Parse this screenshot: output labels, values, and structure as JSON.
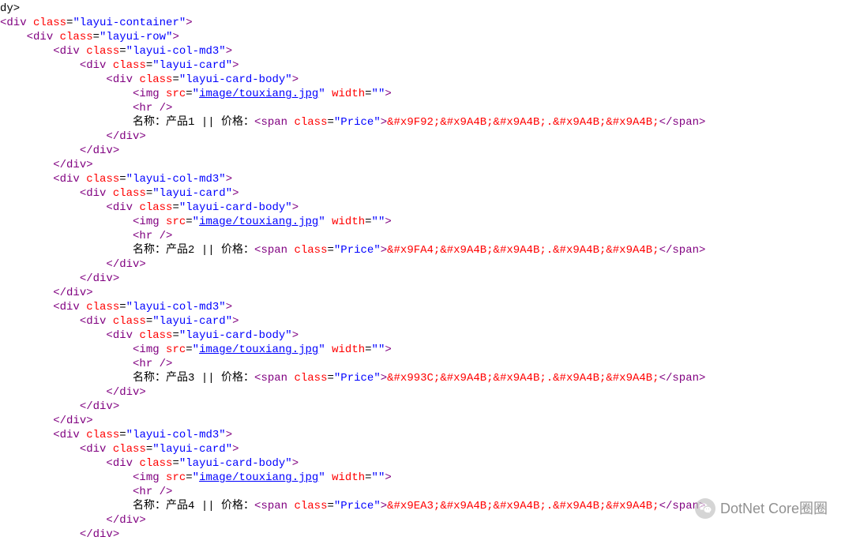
{
  "watermark": {
    "text": "DotNet Core圈圈"
  },
  "common": {
    "tag_div": "div",
    "tag_img": "img",
    "tag_hr": "hr /",
    "tag_span": "span",
    "attr_class": "class",
    "attr_src": "src",
    "attr_width": "width",
    "val_container": "layui-container",
    "val_row": "layui-row",
    "val_col": "layui-col-md3",
    "val_card": "layui-card",
    "val_body": "layui-card-body",
    "val_price": "Price",
    "img_src": "image/touxiang.jpg",
    "img_width": ""
  },
  "root": {
    "body_open": "dy>"
  },
  "blocks": [
    {
      "label_prefix": "名称：产品",
      "idx": "1",
      "label_suffix": " || 价格：",
      "entities": "&#x9F92;&#x9A4B;&#x9A4B;.&#x9A4B;&#x9A4B;",
      "show_last_close": true
    },
    {
      "label_prefix": "名称：产品",
      "idx": "2",
      "label_suffix": " || 价格：",
      "entities": "&#x9FA4;&#x9A4B;&#x9A4B;.&#x9A4B;&#x9A4B;",
      "show_last_close": true
    },
    {
      "label_prefix": "名称：产品",
      "idx": "3",
      "label_suffix": " || 价格：",
      "entities": "&#x993C;&#x9A4B;&#x9A4B;.&#x9A4B;&#x9A4B;",
      "show_last_close": true
    },
    {
      "label_prefix": "名称：产品",
      "idx": "4",
      "label_suffix": " || 价格：",
      "entities": "&#x9EA3;&#x9A4B;&#x9A4B;.&#x9A4B;&#x9A4B;",
      "show_last_close": false
    }
  ]
}
